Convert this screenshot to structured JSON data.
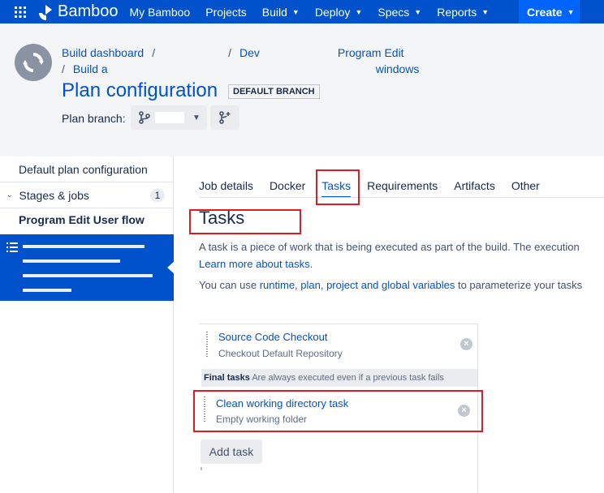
{
  "topnav": {
    "app_name": "Bamboo",
    "links": [
      {
        "label": "My Bamboo",
        "dropdown": false
      },
      {
        "label": "Projects",
        "dropdown": false
      },
      {
        "label": "Build",
        "dropdown": true
      },
      {
        "label": "Deploy",
        "dropdown": true
      },
      {
        "label": "Specs",
        "dropdown": true
      },
      {
        "label": "Reports",
        "dropdown": true
      }
    ],
    "create_label": "Create"
  },
  "header": {
    "breadcrumb_row1": {
      "first": "Build dashboard",
      "second_start": "Dev",
      "second_end": "Program Edit"
    },
    "breadcrumb_row2": {
      "start": "Build a",
      "end": "windows"
    },
    "title": "Plan configuration",
    "branch_badge": "DEFAULT BRANCH",
    "plan_branch_label": "Plan branch:"
  },
  "sidebar": {
    "default_config": "Default plan configuration",
    "stages_label": "Stages & jobs",
    "stages_count": "1",
    "stage_name": "Program Edit User flow"
  },
  "tabs": [
    {
      "label": "Job details",
      "active": false
    },
    {
      "label": "Docker",
      "active": false
    },
    {
      "label": "Tasks",
      "active": true
    },
    {
      "label": "Requirements",
      "active": false
    },
    {
      "label": "Artifacts",
      "active": false
    },
    {
      "label": "Other",
      "active": false
    }
  ],
  "main": {
    "heading": "Tasks",
    "desc_line1": "A task is a piece of work that is being executed as part of the build. The execution",
    "learn_more": "Learn more about tasks.",
    "desc2_prefix": "You can use ",
    "desc2_link": "runtime, plan, project and global variables",
    "desc2_suffix": " to parameterize your tasks"
  },
  "tasks": [
    {
      "title": "Source Code Checkout",
      "subtitle": "Checkout Default Repository"
    }
  ],
  "final_tasks": {
    "label": "Final tasks",
    "note": "Are always executed even if a previous task fails",
    "items": [
      {
        "title": "Clean working directory task",
        "subtitle": "Empty working folder"
      }
    ]
  },
  "add_task_label": "Add task",
  "colors": {
    "nav": "#0052cc",
    "create": "#0065ff",
    "highlight": "#e01b24",
    "link": "#0052cc"
  }
}
